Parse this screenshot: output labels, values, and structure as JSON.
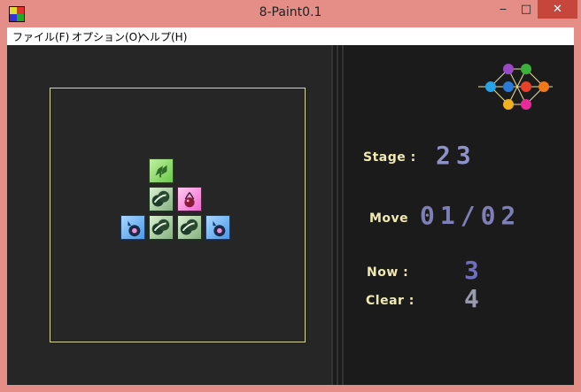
{
  "window": {
    "title": "8-Paint0.1",
    "min_glyph": "‒",
    "max_glyph": "□",
    "close_glyph": "✕"
  },
  "menu": [
    {
      "label": "ファイル(F)"
    },
    {
      "label": "オプション(O)"
    },
    {
      "label": "ヘルプ(H)"
    }
  ],
  "board": {
    "tiles": [
      {
        "kind": "leaf",
        "col": 1,
        "row": 0
      },
      {
        "kind": "twin",
        "col": 1,
        "row": 1
      },
      {
        "kind": "cherry",
        "col": 2,
        "row": 1
      },
      {
        "kind": "drop",
        "col": 0,
        "row": 2
      },
      {
        "kind": "twin",
        "col": 1,
        "row": 2
      },
      {
        "kind": "twin",
        "col": 2,
        "row": 2
      },
      {
        "kind": "drop",
        "col": 3,
        "row": 2
      }
    ],
    "colors": {
      "frame": "#d6d6a0",
      "background": "#262626"
    }
  },
  "info": {
    "stage_label": "Stage :",
    "stage_value": "23",
    "move_label": "Move",
    "move_value": "01/02",
    "now_label": "Now :",
    "now_value": "3",
    "clear_label": "Clear :",
    "clear_value": "4",
    "colors": {
      "label": "#f0eab0",
      "stage": "#8d93c9",
      "move": "#7f7fb8",
      "now": "#6f6fc0",
      "clear": "#9a9ab0"
    }
  },
  "palette_icon": {
    "name": "color-node-graph-icon"
  }
}
